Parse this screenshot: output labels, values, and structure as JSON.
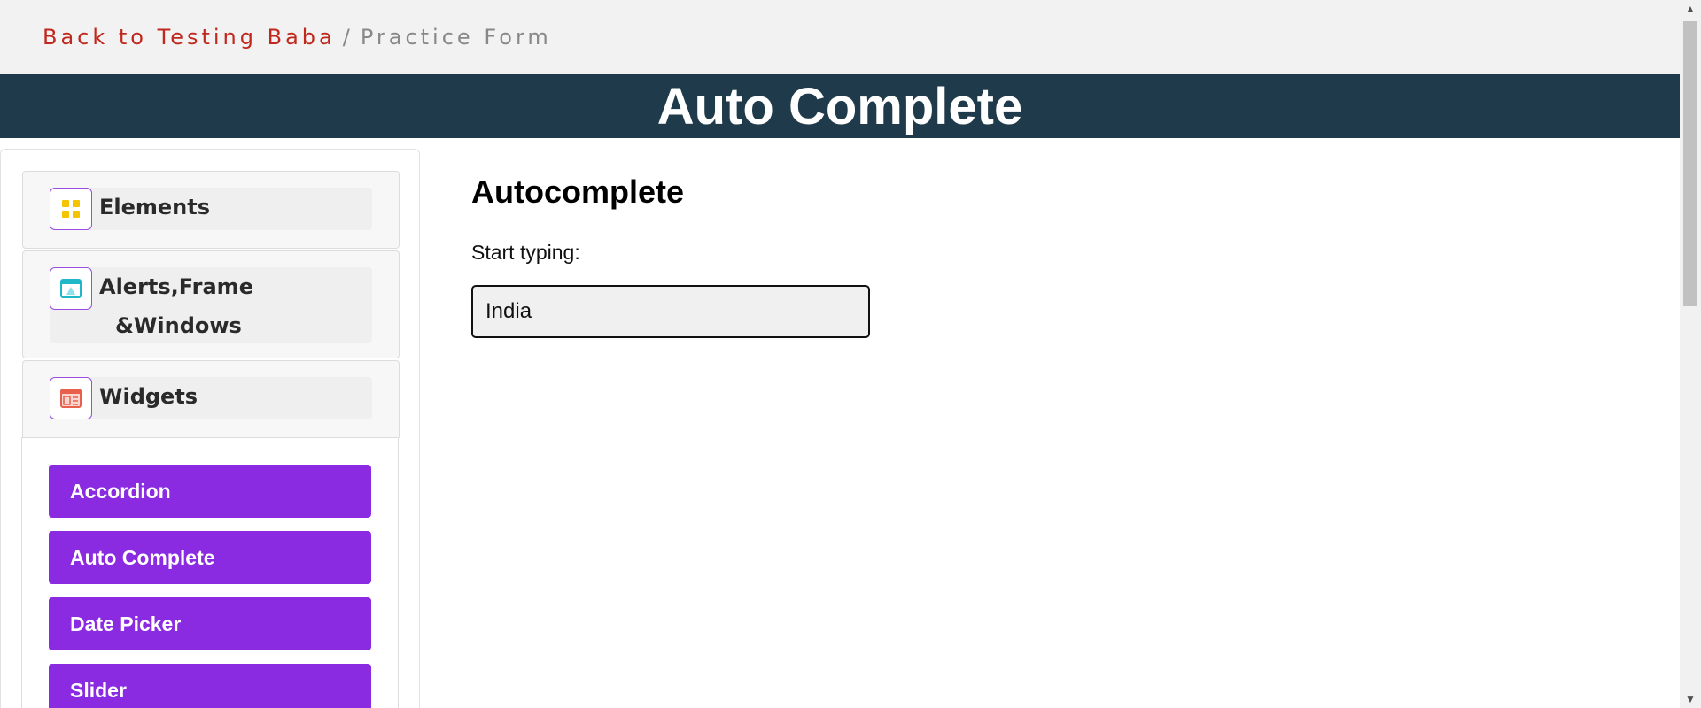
{
  "breadcrumb": {
    "back_link": "Back to Testing Baba",
    "separator": "/",
    "current": "Practice Form"
  },
  "banner": {
    "title": "Auto Complete"
  },
  "sidebar": {
    "groups": [
      {
        "label": "Elements",
        "icon": "grid-icon",
        "icon_color": "#f5c400"
      },
      {
        "label_line1": "Alerts,Frame",
        "label_line2": "&Windows",
        "icon": "window-icon",
        "icon_color": "#1fb8c8"
      },
      {
        "label": "Widgets",
        "icon": "widgets-icon",
        "icon_color": "#e8604c"
      }
    ],
    "widget_items": [
      {
        "label": "Accordion"
      },
      {
        "label": "Auto Complete"
      },
      {
        "label": "Date Picker"
      },
      {
        "label": "Slider"
      }
    ]
  },
  "main": {
    "heading": "Autocomplete",
    "field_label": "Start typing:",
    "input_value": "India"
  },
  "colors": {
    "accent": "#8a2be2",
    "banner": "#1f3a4a",
    "link": "#c0281e"
  }
}
